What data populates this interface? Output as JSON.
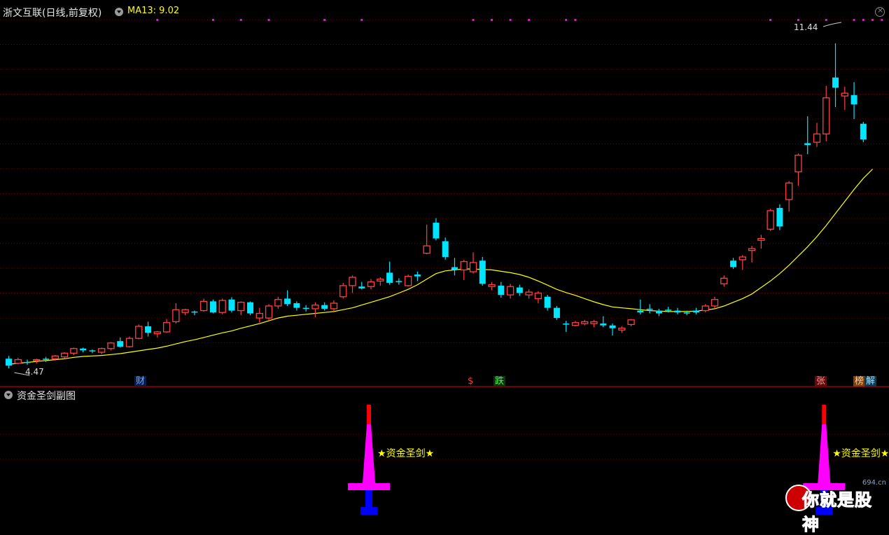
{
  "header": {
    "title": "浙文互联(日线,前复权)",
    "ma_label": "MA13: 9.02",
    "sub_title": "资金圣剑副图"
  },
  "markers": {
    "low_label": "4.47",
    "high_label": "11.44",
    "tags": [
      "财",
      "$",
      "跌",
      "张",
      "榜",
      "解"
    ],
    "sword_text": "★资金圣剑★"
  },
  "watermark": {
    "text": "你就是股神",
    "site": "694.cn"
  },
  "colors": {
    "background": "#000000",
    "up": "#ff4040",
    "down": "#00e5ff",
    "ma": "#ffff00",
    "divider": "#990000",
    "grid": "#6a0000",
    "signal_dot": "#ff00ff",
    "sword_mid": "#ff00ff",
    "sword_top": "#ff0000",
    "sword_base": "#0000ff"
  },
  "chart_data": {
    "type": "candlestick",
    "title": "浙文互联(日线,前复权)",
    "ylim": [
      4.2,
      11.8
    ],
    "candles": [
      [
        4.47,
        4.68,
        4.41,
        4.62,
        "down"
      ],
      [
        4.6,
        4.64,
        4.5,
        4.52,
        "up"
      ],
      [
        4.54,
        4.6,
        4.49,
        4.55,
        "down"
      ],
      [
        4.58,
        4.62,
        4.52,
        4.6,
        "up"
      ],
      [
        4.6,
        4.66,
        4.55,
        4.62,
        "down"
      ],
      [
        4.62,
        4.7,
        4.58,
        4.68,
        "up"
      ],
      [
        4.66,
        4.76,
        4.62,
        4.74,
        "up"
      ],
      [
        4.74,
        4.86,
        4.7,
        4.84,
        "up"
      ],
      [
        4.84,
        4.86,
        4.76,
        4.8,
        "down"
      ],
      [
        4.8,
        4.82,
        4.74,
        4.78,
        "down"
      ],
      [
        4.76,
        4.86,
        4.72,
        4.84,
        "up"
      ],
      [
        4.84,
        4.98,
        4.8,
        4.96,
        "up"
      ],
      [
        5.0,
        5.08,
        4.86,
        4.88,
        "down"
      ],
      [
        4.88,
        5.1,
        4.86,
        5.06,
        "up"
      ],
      [
        5.06,
        5.36,
        5.04,
        5.32,
        "up"
      ],
      [
        5.32,
        5.42,
        5.1,
        5.18,
        "down"
      ],
      [
        5.16,
        5.22,
        5.08,
        5.2,
        "up"
      ],
      [
        5.2,
        5.48,
        5.18,
        5.4,
        "up"
      ],
      [
        5.42,
        5.82,
        5.38,
        5.68,
        "up"
      ],
      [
        5.68,
        5.7,
        5.56,
        5.62,
        "up"
      ],
      [
        5.62,
        5.66,
        5.56,
        5.64,
        "down"
      ],
      [
        5.66,
        5.92,
        5.64,
        5.86,
        "up"
      ],
      [
        5.86,
        5.9,
        5.6,
        5.62,
        "down"
      ],
      [
        5.62,
        5.92,
        5.58,
        5.88,
        "up"
      ],
      [
        5.9,
        5.95,
        5.62,
        5.66,
        "down"
      ],
      [
        5.66,
        5.86,
        5.56,
        5.84,
        "up"
      ],
      [
        5.84,
        5.86,
        5.56,
        5.6,
        "down"
      ],
      [
        5.6,
        5.72,
        5.4,
        5.5,
        "up"
      ],
      [
        5.5,
        5.8,
        5.44,
        5.76,
        "up"
      ],
      [
        5.76,
        5.96,
        5.7,
        5.9,
        "up"
      ],
      [
        5.92,
        6.1,
        5.76,
        5.8,
        "down"
      ],
      [
        5.82,
        5.86,
        5.66,
        5.72,
        "down"
      ],
      [
        5.72,
        5.78,
        5.64,
        5.7,
        "down"
      ],
      [
        5.7,
        5.84,
        5.52,
        5.78,
        "up"
      ],
      [
        5.78,
        5.84,
        5.66,
        5.7,
        "down"
      ],
      [
        5.7,
        5.88,
        5.64,
        5.82,
        "up"
      ],
      [
        5.96,
        6.26,
        5.92,
        6.2,
        "up"
      ],
      [
        6.2,
        6.42,
        6.04,
        6.38,
        "up"
      ],
      [
        6.18,
        6.28,
        6.12,
        6.14,
        "down"
      ],
      [
        6.18,
        6.34,
        6.12,
        6.28,
        "up"
      ],
      [
        6.3,
        6.38,
        6.2,
        6.34,
        "up"
      ],
      [
        6.26,
        6.72,
        6.22,
        6.48,
        "down"
      ],
      [
        6.3,
        6.36,
        6.22,
        6.28,
        "down"
      ],
      [
        6.2,
        6.44,
        6.18,
        6.4,
        "up"
      ],
      [
        6.4,
        6.5,
        6.3,
        6.44,
        "down"
      ],
      [
        6.9,
        7.52,
        6.88,
        7.06,
        "up"
      ],
      [
        7.56,
        7.66,
        7.18,
        7.22,
        "down"
      ],
      [
        7.16,
        7.24,
        6.76,
        6.82,
        "down"
      ],
      [
        6.54,
        6.8,
        6.42,
        6.6,
        "down"
      ],
      [
        6.54,
        6.76,
        6.32,
        6.72,
        "up"
      ],
      [
        6.7,
        6.92,
        6.46,
        6.5,
        "up"
      ],
      [
        6.74,
        6.82,
        6.2,
        6.24,
        "down"
      ],
      [
        6.22,
        6.28,
        6.1,
        6.18,
        "up"
      ],
      [
        6.2,
        6.28,
        5.94,
        6.0,
        "down"
      ],
      [
        6.0,
        6.24,
        5.92,
        6.18,
        "up"
      ],
      [
        6.16,
        6.22,
        5.98,
        6.04,
        "down"
      ],
      [
        6.06,
        6.12,
        5.92,
        6.0,
        "up"
      ],
      [
        5.92,
        6.08,
        5.82,
        6.04,
        "up"
      ],
      [
        5.96,
        6.0,
        5.66,
        5.72,
        "down"
      ],
      [
        5.72,
        5.76,
        5.46,
        5.5,
        "down"
      ],
      [
        5.38,
        5.44,
        5.2,
        5.38,
        "down"
      ],
      [
        5.34,
        5.44,
        5.32,
        5.4,
        "up"
      ],
      [
        5.38,
        5.46,
        5.34,
        5.42,
        "up"
      ],
      [
        5.42,
        5.46,
        5.3,
        5.38,
        "up"
      ],
      [
        5.38,
        5.54,
        5.3,
        5.34,
        "down"
      ],
      [
        5.34,
        5.38,
        5.12,
        5.28,
        "down"
      ],
      [
        5.28,
        5.32,
        5.18,
        5.24,
        "up"
      ],
      [
        5.36,
        5.48,
        5.32,
        5.46,
        "up"
      ],
      [
        5.62,
        5.9,
        5.58,
        5.66,
        "down"
      ],
      [
        5.68,
        5.8,
        5.6,
        5.7,
        "down"
      ],
      [
        5.66,
        5.7,
        5.54,
        5.6,
        "down"
      ],
      [
        5.66,
        5.74,
        5.62,
        5.68,
        "down"
      ],
      [
        5.66,
        5.72,
        5.58,
        5.62,
        "down"
      ],
      [
        5.62,
        5.66,
        5.56,
        5.6,
        "down"
      ],
      [
        5.66,
        5.72,
        5.58,
        5.62,
        "down"
      ],
      [
        5.66,
        5.8,
        5.62,
        5.76,
        "up"
      ],
      [
        5.76,
        5.96,
        5.7,
        5.9,
        "up"
      ],
      [
        6.24,
        6.42,
        6.18,
        6.36,
        "up"
      ],
      [
        6.6,
        6.8,
        6.56,
        6.74,
        "down"
      ],
      [
        6.76,
        6.86,
        6.54,
        6.82,
        "up"
      ],
      [
        6.96,
        7.06,
        6.7,
        7.0,
        "up"
      ],
      [
        7.18,
        7.3,
        7.0,
        7.22,
        "up"
      ],
      [
        7.42,
        7.86,
        7.38,
        7.82,
        "up"
      ],
      [
        7.88,
        7.96,
        7.4,
        7.48,
        "down"
      ],
      [
        8.42,
        8.46,
        7.8,
        8.06,
        "up"
      ],
      [
        8.66,
        9.06,
        8.36,
        9.02,
        "up"
      ],
      [
        9.28,
        9.86,
        9.04,
        9.24,
        "down"
      ],
      [
        9.48,
        9.72,
        9.2,
        9.3,
        "up"
      ],
      [
        9.48,
        10.52,
        9.32,
        10.26,
        "up"
      ],
      [
        10.7,
        11.44,
        10.06,
        10.48,
        "down"
      ],
      [
        10.3,
        10.5,
        10.0,
        10.36,
        "up"
      ],
      [
        10.32,
        10.6,
        9.8,
        10.12,
        "down"
      ],
      [
        9.7,
        9.74,
        9.3,
        9.36,
        "down"
      ]
    ],
    "ma13": [
      4.5,
      4.52,
      4.54,
      4.56,
      4.58,
      4.6,
      4.62,
      4.65,
      4.67,
      4.68,
      4.69,
      4.71,
      4.73,
      4.76,
      4.79,
      4.82,
      4.85,
      4.89,
      4.94,
      4.99,
      5.03,
      5.08,
      5.13,
      5.18,
      5.22,
      5.28,
      5.33,
      5.38,
      5.44,
      5.5,
      5.54,
      5.56,
      5.58,
      5.6,
      5.62,
      5.64,
      5.68,
      5.72,
      5.78,
      5.84,
      5.9,
      5.96,
      6.04,
      6.12,
      6.22,
      6.34,
      6.46,
      6.52,
      6.54,
      6.56,
      6.56,
      6.55,
      6.54,
      6.51,
      6.48,
      6.44,
      6.38,
      6.3,
      6.21,
      6.12,
      6.05,
      5.99,
      5.92,
      5.85,
      5.79,
      5.74,
      5.72,
      5.7,
      5.68,
      5.66,
      5.65,
      5.64,
      5.64,
      5.64,
      5.65,
      5.67,
      5.7,
      5.76,
      5.84,
      5.92,
      6.02,
      6.16,
      6.3,
      6.46,
      6.64,
      6.84,
      7.04,
      7.26,
      7.5,
      7.76,
      8.02,
      8.28,
      8.52,
      8.72
    ],
    "signals": {
      "dots_candle_index": [
        16,
        22,
        25,
        28,
        34,
        38,
        50,
        52,
        54,
        56,
        60,
        61,
        82,
        85,
        88,
        91,
        92,
        93,
        94,
        95,
        96
      ],
      "sword_candle_index": [
        39,
        88
      ]
    }
  }
}
